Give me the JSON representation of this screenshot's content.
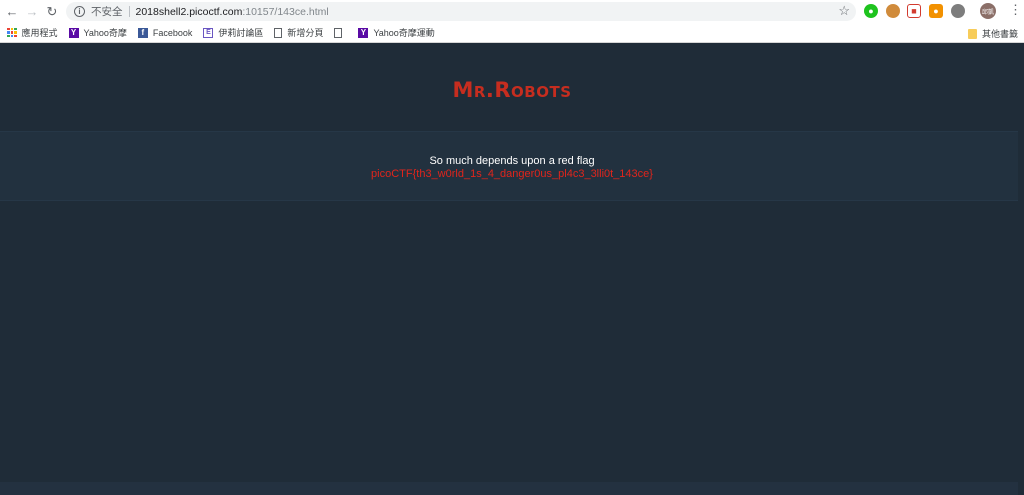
{
  "browser": {
    "security_label": "不安全",
    "url_host": "2018shell2.picoctf.com",
    "url_path": ":10157/143ce.html",
    "avatar_text": "邱凱"
  },
  "bookmarks": [
    {
      "label": "應用程式",
      "icon": "apps-grid-icon"
    },
    {
      "label": "Yahoo奇摩",
      "icon": "yahoo-icon"
    },
    {
      "label": "Facebook",
      "icon": "facebook-icon"
    },
    {
      "label": "伊莉討論區",
      "icon": "forum-icon"
    },
    {
      "label": "新增分頁",
      "icon": "page-icon"
    },
    {
      "label": "",
      "icon": "page-icon"
    },
    {
      "label": "Yahoo奇摩運動",
      "icon": "yahoo-icon"
    }
  ],
  "other_bookmarks": "其他書籤",
  "site": {
    "title": "Mr.Robots",
    "message": "So much depends upon a red flag",
    "flag": "picoCTF{th3_w0rld_1s_4_danger0us_pl4c3_3lli0t_143ce}"
  },
  "colors": {
    "background": "#1f2c38",
    "banner": "#22313f",
    "title_red": "#c62d1f",
    "flag_red": "#e0251c"
  }
}
